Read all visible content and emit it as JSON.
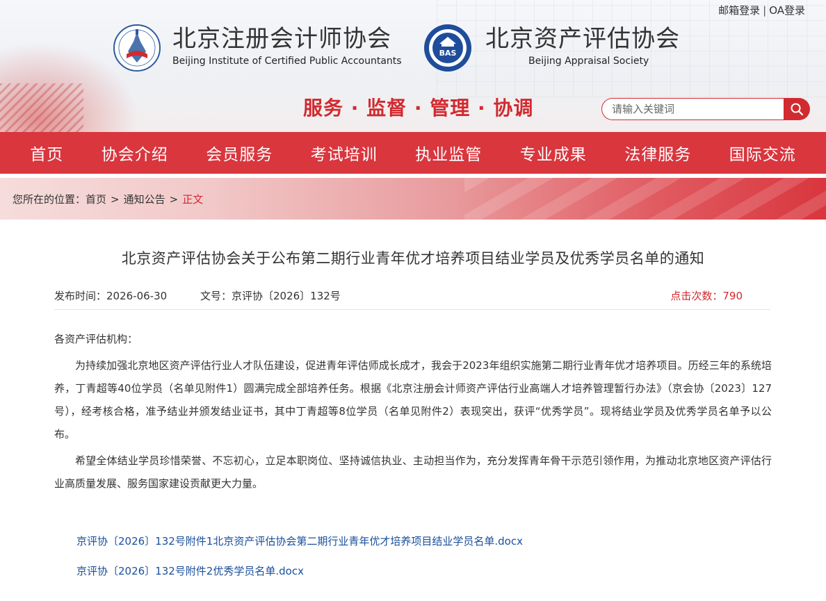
{
  "top_links": {
    "mail_login": "邮箱登录",
    "separator": "|",
    "oa_login": "OA登录"
  },
  "brands": [
    {
      "name_cn": "北京注册会计师协会",
      "name_en": "Beijing Institute of Certified Public Accountants",
      "logo_icon": "bicpa-emblem-icon"
    },
    {
      "name_cn": "北京资产评估协会",
      "name_en": "Beijing Appraisal Society",
      "logo_icon": "bas-emblem-icon",
      "logo_text": "BAS"
    }
  ],
  "slogan": "服务 · 监督 · 管理 · 协调",
  "search": {
    "placeholder": "请输入关键词",
    "icon": "search-icon"
  },
  "nav": {
    "items": [
      "首页",
      "协会介绍",
      "会员服务",
      "考试培训",
      "执业监管",
      "专业成果",
      "法律服务",
      "国际交流"
    ]
  },
  "breadcrumb": {
    "prefix": "您所在的位置：",
    "home": "首页",
    "section": "通知公告",
    "current": "正文",
    "separator": ">"
  },
  "article": {
    "title": "北京资产评估协会关于公布第二期行业青年优才培养项目结业学员及优秀学员名单的通知",
    "publish_time": "发布时间：2026-06-30",
    "doc_no": "文号：京评协〔2026〕132号",
    "views": "点击次数：790",
    "salutation": "各资产评估机构：",
    "paragraphs": [
      "为持续加强北京地区资产评估行业人才队伍建设，促进青年评估师成长成才，我会于2023年组织实施第二期行业青年优才培养项目。历经三年的系统培养，丁青超等40位学员（名单见附件1）圆满完成全部培养任务。根据《北京注册会计师资产评估行业高端人才培养管理暂行办法》（京会协〔2023〕127号），经考核合格，准予结业并颁发结业证书，其中丁青超等8位学员（名单见附件2）表现突出，获评“优秀学员”。现将结业学员及优秀学员名单予以公布。",
      "希望全体结业学员珍惜荣誉、不忘初心，立足本职岗位、坚持诚信执业、主动担当作为，充分发挥青年骨干示范引领作用，为推动北京地区资产评估行业高质量发展、服务国家建设贡献更大力量。"
    ],
    "attachments": [
      "京评协〔2026〕132号附件1北京资产评估协会第二期行业青年优才培养项目结业学员名单.docx",
      "京评协〔2026〕132号附件2优秀学员名单.docx"
    ]
  },
  "colors": {
    "brand_red": "#d9363e",
    "accent_red": "#d12a2f",
    "link_blue": "#1a4f9a"
  }
}
